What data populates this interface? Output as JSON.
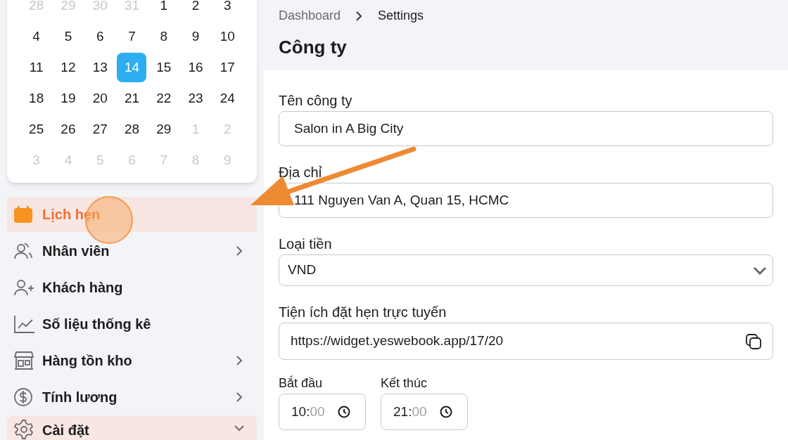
{
  "calendar": {
    "weeks": [
      [
        {
          "day": "28",
          "muted": true,
          "selected": false
        },
        {
          "day": "29",
          "muted": true,
          "selected": false
        },
        {
          "day": "30",
          "muted": true,
          "selected": false
        },
        {
          "day": "31",
          "muted": true,
          "selected": false
        },
        {
          "day": "1",
          "muted": false,
          "selected": false
        },
        {
          "day": "2",
          "muted": false,
          "selected": false
        },
        {
          "day": "3",
          "muted": false,
          "selected": false
        }
      ],
      [
        {
          "day": "4",
          "muted": false,
          "selected": false
        },
        {
          "day": "5",
          "muted": false,
          "selected": false
        },
        {
          "day": "6",
          "muted": false,
          "selected": false
        },
        {
          "day": "7",
          "muted": false,
          "selected": false
        },
        {
          "day": "8",
          "muted": false,
          "selected": false
        },
        {
          "day": "9",
          "muted": false,
          "selected": false
        },
        {
          "day": "10",
          "muted": false,
          "selected": false
        }
      ],
      [
        {
          "day": "11",
          "muted": false,
          "selected": false
        },
        {
          "day": "12",
          "muted": false,
          "selected": false
        },
        {
          "day": "13",
          "muted": false,
          "selected": false
        },
        {
          "day": "14",
          "muted": false,
          "selected": true
        },
        {
          "day": "15",
          "muted": false,
          "selected": false
        },
        {
          "day": "16",
          "muted": false,
          "selected": false
        },
        {
          "day": "17",
          "muted": false,
          "selected": false
        }
      ],
      [
        {
          "day": "18",
          "muted": false,
          "selected": false
        },
        {
          "day": "19",
          "muted": false,
          "selected": false
        },
        {
          "day": "20",
          "muted": false,
          "selected": false
        },
        {
          "day": "21",
          "muted": false,
          "selected": false
        },
        {
          "day": "22",
          "muted": false,
          "selected": false
        },
        {
          "day": "23",
          "muted": false,
          "selected": false
        },
        {
          "day": "24",
          "muted": false,
          "selected": false
        }
      ],
      [
        {
          "day": "25",
          "muted": false,
          "selected": false
        },
        {
          "day": "26",
          "muted": false,
          "selected": false
        },
        {
          "day": "27",
          "muted": false,
          "selected": false
        },
        {
          "day": "28",
          "muted": false,
          "selected": false
        },
        {
          "day": "29",
          "muted": false,
          "selected": false
        },
        {
          "day": "1",
          "muted": true,
          "selected": false
        },
        {
          "day": "2",
          "muted": true,
          "selected": false
        }
      ],
      [
        {
          "day": "3",
          "muted": true,
          "selected": false
        },
        {
          "day": "4",
          "muted": true,
          "selected": false
        },
        {
          "day": "5",
          "muted": true,
          "selected": false
        },
        {
          "day": "6",
          "muted": true,
          "selected": false
        },
        {
          "day": "7",
          "muted": true,
          "selected": false
        },
        {
          "day": "8",
          "muted": true,
          "selected": false
        },
        {
          "day": "9",
          "muted": true,
          "selected": false
        }
      ]
    ]
  },
  "sidebar": {
    "items": [
      {
        "kind": "calendar",
        "label": "Lịch hẹn",
        "selected": true,
        "expanded": false,
        "expandable": false
      },
      {
        "kind": "users",
        "label": "Nhân viên",
        "selected": false,
        "expanded": false,
        "expandable": true
      },
      {
        "kind": "user-plus",
        "label": "Khách hàng",
        "selected": false,
        "expanded": false,
        "expandable": false
      },
      {
        "kind": "chart",
        "label": "Số liệu thống kê",
        "selected": false,
        "expanded": false,
        "expandable": false
      },
      {
        "kind": "store",
        "label": "Hàng tồn kho",
        "selected": false,
        "expanded": false,
        "expandable": true
      },
      {
        "kind": "dollar",
        "label": "Tính lương",
        "selected": false,
        "expanded": false,
        "expandable": true
      },
      {
        "kind": "gear",
        "label": "Cài đặt",
        "selected": false,
        "expanded": true,
        "expandable": true
      }
    ]
  },
  "breadcrumb": [
    "Dashboard",
    "Settings"
  ],
  "title": "Công ty",
  "form": {
    "fields": [
      {
        "kind": "text",
        "label": "Tên công ty",
        "value": "Salon in A Big City"
      },
      {
        "kind": "text",
        "label": "Địa chỉ",
        "value": "111 Nguyen Van A, Quan 15, HCMC"
      },
      {
        "kind": "select",
        "label": "Loại tiền",
        "value": "VND"
      },
      {
        "kind": "copy",
        "label": "Tiện ích đặt hẹn trực tuyến",
        "value": "https://widget.yeswebook.app/17/20"
      }
    ],
    "times": [
      {
        "label": "Bắt đầu",
        "hour": "10:",
        "minute": "00"
      },
      {
        "label": "Kết thúc",
        "hour": "21:",
        "minute": "00"
      }
    ]
  }
}
